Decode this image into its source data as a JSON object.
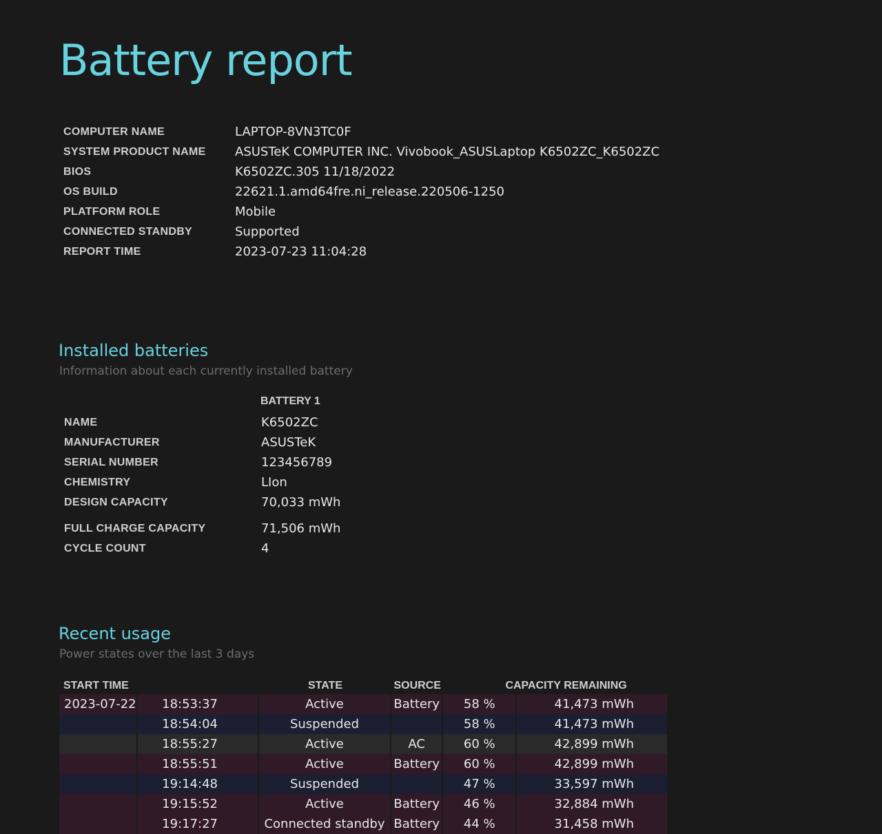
{
  "title": "Battery report",
  "system_info": [
    {
      "label": "COMPUTER NAME",
      "value": "LAPTOP-8VN3TC0F"
    },
    {
      "label": "SYSTEM PRODUCT NAME",
      "value": "ASUSTeK COMPUTER INC. Vivobook_ASUSLaptop K6502ZC_K6502ZC"
    },
    {
      "label": "BIOS",
      "value": "K6502ZC.305 11/18/2022"
    },
    {
      "label": "OS BUILD",
      "value": "22621.1.amd64fre.ni_release.220506-1250"
    },
    {
      "label": "PLATFORM ROLE",
      "value": "Mobile"
    },
    {
      "label": "CONNECTED STANDBY",
      "value": "Supported"
    },
    {
      "label": "REPORT TIME",
      "value": "2023-07-23  11:04:28"
    }
  ],
  "installed_batteries": {
    "title": "Installed batteries",
    "subtitle": "Information about each currently installed battery",
    "column_header": "BATTERY 1",
    "rows": [
      {
        "label": "NAME",
        "value": "K6502ZC"
      },
      {
        "label": "MANUFACTURER",
        "value": "ASUSTeK"
      },
      {
        "label": "SERIAL NUMBER",
        "value": "123456789"
      },
      {
        "label": "CHEMISTRY",
        "value": "LIon"
      },
      {
        "label": "DESIGN CAPACITY",
        "value": "70,033 mWh"
      },
      {
        "label": "FULL CHARGE CAPACITY",
        "value": "71,506 mWh"
      },
      {
        "label": "CYCLE COUNT",
        "value": "4"
      }
    ]
  },
  "recent_usage": {
    "title": "Recent usage",
    "subtitle": "Power states over the last 3 days",
    "headers": {
      "start_time": "START TIME",
      "state": "STATE",
      "source": "SOURCE",
      "capacity_remaining": "CAPACITY REMAINING"
    },
    "rows": [
      {
        "date": "2023-07-22",
        "time": "18:53:37",
        "state": "Active",
        "source": "Battery",
        "percent": "58 %",
        "mwh": "41,473 mWh",
        "row_type": "battery"
      },
      {
        "date": "",
        "time": "18:54:04",
        "state": "Suspended",
        "source": "",
        "percent": "58 %",
        "mwh": "41,473 mWh",
        "row_type": "suspended"
      },
      {
        "date": "",
        "time": "18:55:27",
        "state": "Active",
        "source": "AC",
        "percent": "60 %",
        "mwh": "42,899 mWh",
        "row_type": "ac"
      },
      {
        "date": "",
        "time": "18:55:51",
        "state": "Active",
        "source": "Battery",
        "percent": "60 %",
        "mwh": "42,899 mWh",
        "row_type": "battery"
      },
      {
        "date": "",
        "time": "19:14:48",
        "state": "Suspended",
        "source": "",
        "percent": "47 %",
        "mwh": "33,597 mWh",
        "row_type": "suspended"
      },
      {
        "date": "",
        "time": "19:15:52",
        "state": "Active",
        "source": "Battery",
        "percent": "46 %",
        "mwh": "32,884 mWh",
        "row_type": "battery"
      },
      {
        "date": "",
        "time": "19:17:27",
        "state": "Connected standby",
        "source": "Battery",
        "percent": "44 %",
        "mwh": "31,458 mWh",
        "row_type": "battery"
      }
    ]
  },
  "colors": {
    "background": "#1a1a1a",
    "accent": "#67d3e0",
    "battery_row": "#311a28",
    "suspended_row": "#1c1e32",
    "ac_row": "#2a2a2a"
  }
}
